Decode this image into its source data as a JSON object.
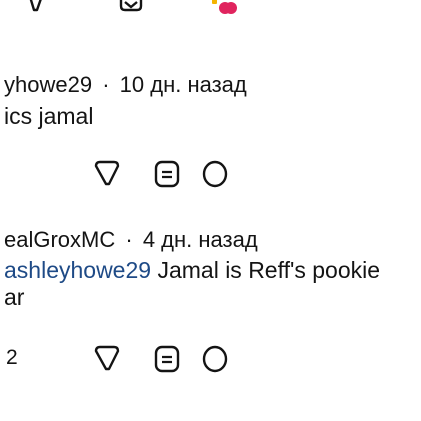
{
  "top_actions": {
    "icons": [
      "reply-icon",
      "save-icon",
      "heart-reaction-icon"
    ]
  },
  "comments": [
    {
      "author": "yhowe29",
      "separator": "·",
      "time": "10 дн. назад",
      "text": "ics jamal",
      "actions": [
        "reply-icon",
        "bookmark-icon",
        "comment-icon"
      ]
    },
    {
      "author": "ealGroxMC",
      "separator": "·",
      "time": "4 дн. назад",
      "mention": "ashleyhowe29",
      "text_after_mention": " Jamal is Reff's pookie",
      "text_line2": "ar",
      "count": "2",
      "actions": [
        "reply-icon",
        "bookmark-icon",
        "comment-icon"
      ]
    }
  ],
  "colors": {
    "text": "#141414",
    "mention": "#1e4a86",
    "reaction_red": "#e0245e",
    "reaction_gold": "#f4b400"
  }
}
